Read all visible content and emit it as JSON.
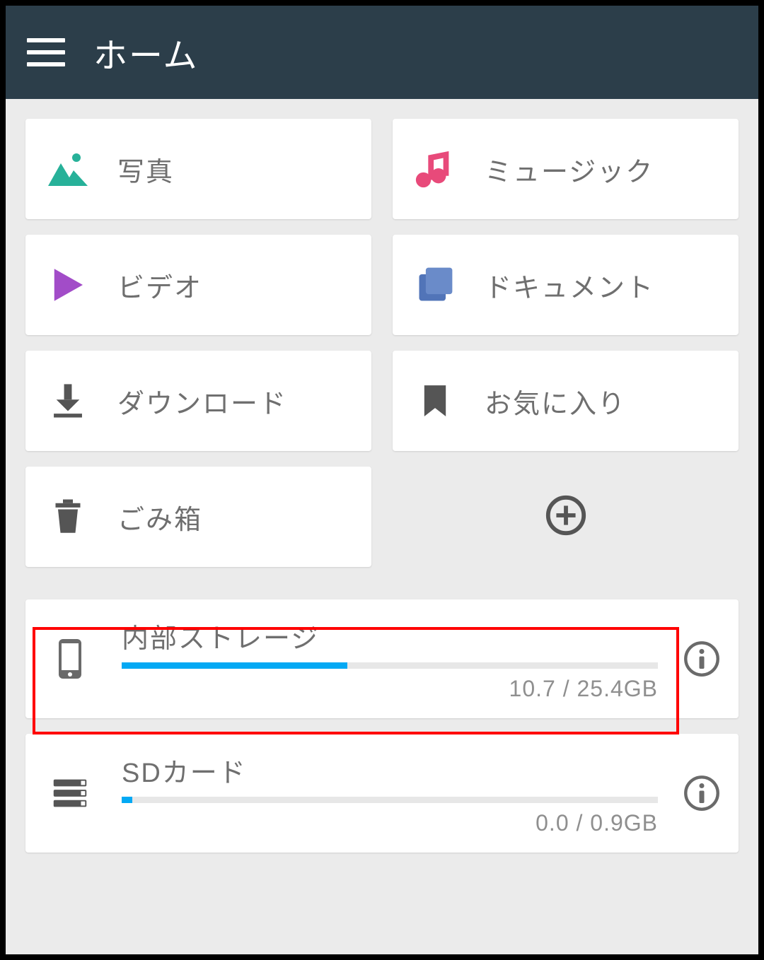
{
  "appbar": {
    "title": "ホーム"
  },
  "tiles": [
    {
      "label": "写真",
      "icon": "photo-icon"
    },
    {
      "label": "ミュージック",
      "icon": "music-icon"
    },
    {
      "label": "ビデオ",
      "icon": "video-icon"
    },
    {
      "label": "ドキュメント",
      "icon": "document-icon"
    },
    {
      "label": "ダウンロード",
      "icon": "download-icon"
    },
    {
      "label": "お気に入り",
      "icon": "bookmark-icon"
    },
    {
      "label": "ごみ箱",
      "icon": "trash-icon"
    }
  ],
  "storage": [
    {
      "title": "内部ストレージ",
      "usage_text": "10.7 / 25.4GB",
      "used": 10.7,
      "total": 25.4,
      "fill_percent": 42.1,
      "icon": "phone-icon",
      "highlighted": true
    },
    {
      "title": "SDカード",
      "usage_text": "0.0 / 0.9GB",
      "used": 0.0,
      "total": 0.9,
      "fill_percent": 2,
      "icon": "sdcard-icon",
      "highlighted": false
    }
  ],
  "icons": {
    "add": "add-icon",
    "info": "info-icon",
    "menu": "menu-icon"
  }
}
